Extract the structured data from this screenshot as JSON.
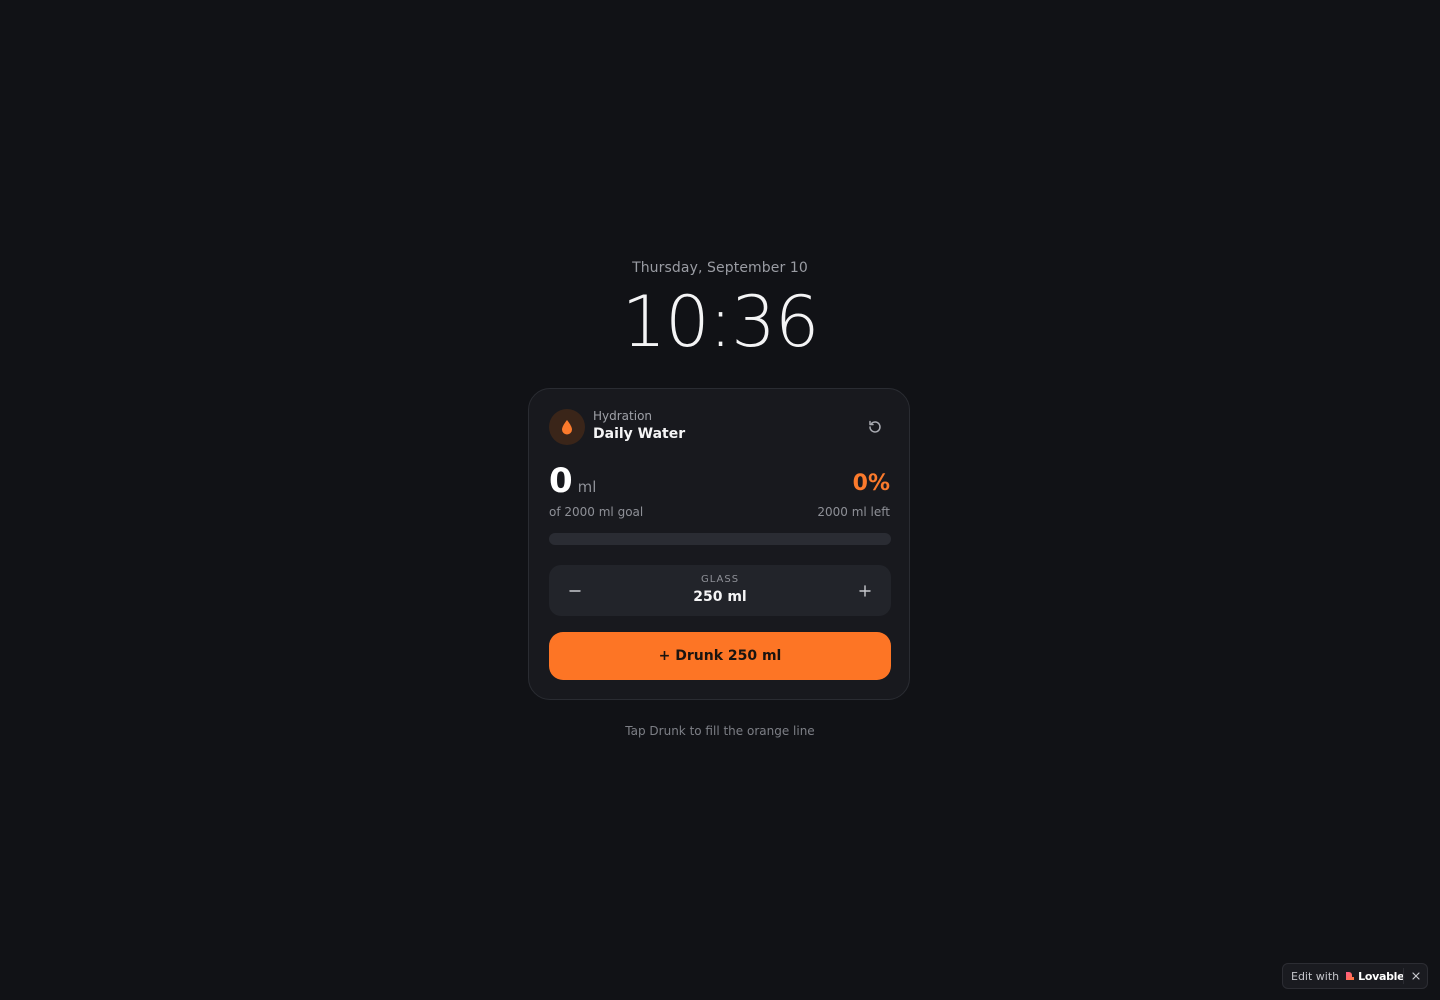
{
  "header": {
    "date": "Thursday, September 10",
    "time": "10:36"
  },
  "card": {
    "kicker": "Hydration",
    "title": "Daily Water",
    "icon": "water-drop-icon",
    "reset_icon": "reset-icon",
    "amount": {
      "value": "0",
      "unit": "ml"
    },
    "goal_text": "of 2000 ml goal",
    "percent_text": "0%",
    "remaining_text": "2000 ml left",
    "progress_fraction": 0,
    "glass": {
      "label": "GLASS",
      "value": "250 ml",
      "decrement_icon": "minus-icon",
      "increment_icon": "plus-icon"
    },
    "drunk_button_label": "+ Drunk 250 ml"
  },
  "hint": "Tap Drunk to fill the orange line",
  "badge": {
    "edit_text": "Edit with",
    "brand": "Lovable",
    "logo_icon": "lovable-heart-icon",
    "close_icon": "close-icon"
  },
  "colors": {
    "background": "#111216",
    "card": "#18191e",
    "accent": "#fd7525",
    "accent_text": "#fb7a2c",
    "track": "#2a2c33"
  }
}
